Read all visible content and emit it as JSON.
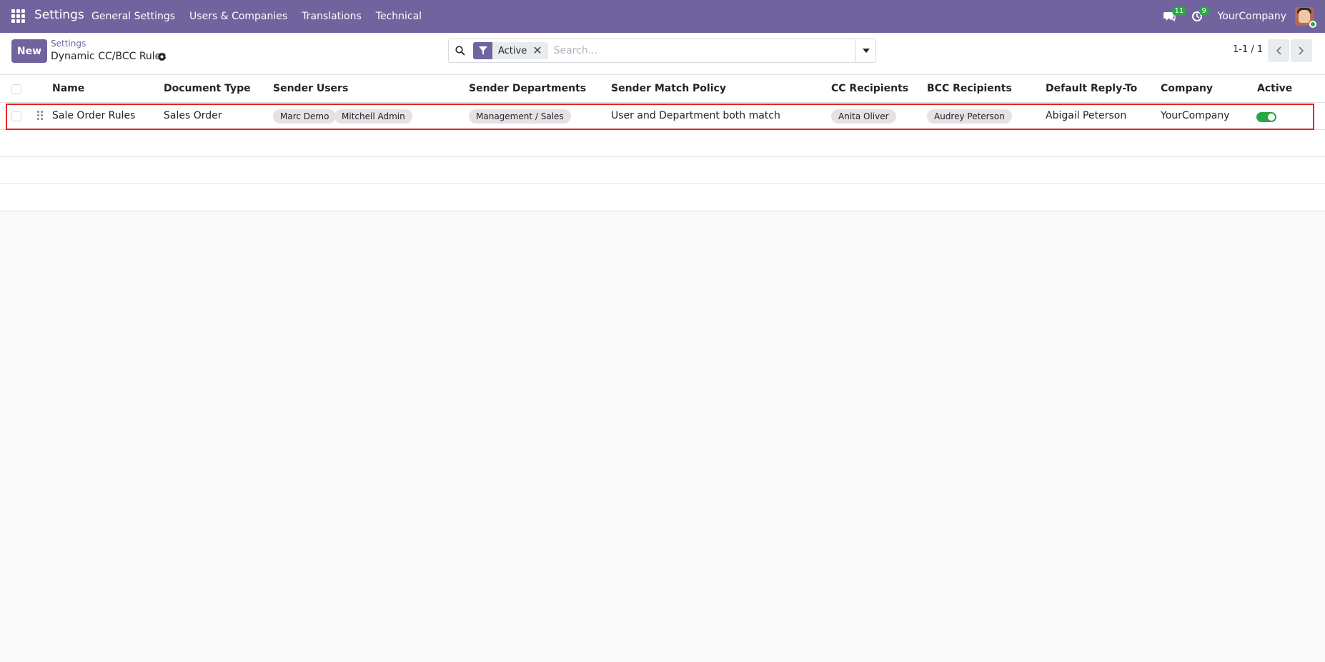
{
  "navbar": {
    "app_name": "Settings",
    "menu": [
      "General Settings",
      "Users & Companies",
      "Translations",
      "Technical"
    ],
    "messages_count": "11",
    "activities_count": "9",
    "company": "YourCompany"
  },
  "control": {
    "new_label": "New",
    "breadcrumb_parent": "Settings",
    "breadcrumb_current": "Dynamic CC/BCC Rules",
    "facet_label": "Active",
    "search_placeholder": "Search...",
    "pager": "1-1 / 1"
  },
  "table": {
    "columns": [
      "Name",
      "Document Type",
      "Sender Users",
      "Sender Departments",
      "Sender Match Policy",
      "CC Recipients",
      "BCC Recipients",
      "Default Reply-To",
      "Company",
      "Active"
    ],
    "rows": [
      {
        "name": "Sale Order Rules",
        "document_type": "Sales Order",
        "sender_users": [
          "Marc Demo",
          "Mitchell Admin"
        ],
        "sender_departments": [
          "Management / Sales"
        ],
        "sender_match_policy": "User and Department both match",
        "cc_recipients": [
          "Anita Oliver"
        ],
        "bcc_recipients": [
          "Audrey Peterson"
        ],
        "default_reply_to": "Abigail Peterson",
        "company": "YourCompany",
        "active": true
      }
    ]
  },
  "colors": {
    "brand": "#71639e",
    "toggle_on": "#28a745",
    "highlight": "#e02424"
  }
}
